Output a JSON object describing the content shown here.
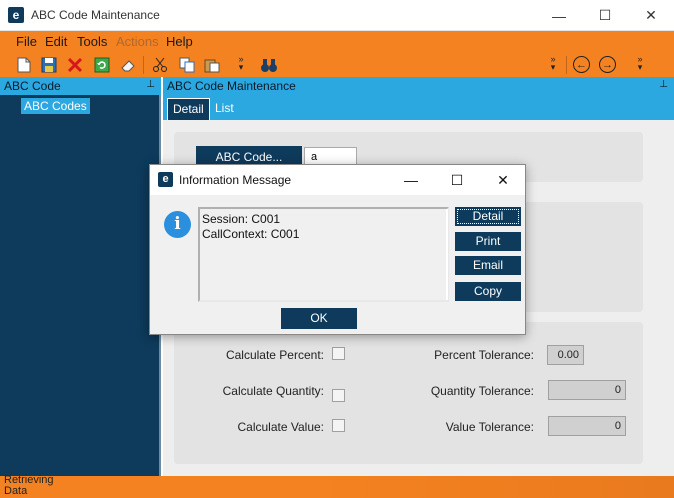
{
  "window": {
    "title": "ABC Code Maintenance",
    "minimize": "—",
    "maximize": "☐",
    "close": "✕"
  },
  "menu": {
    "items": [
      "File",
      "Edit",
      "Tools",
      "Actions",
      "Help"
    ],
    "disabled": [
      "Actions"
    ]
  },
  "toolbar": {
    "icons": [
      "new-icon",
      "save-icon",
      "delete-icon",
      "refresh-icon",
      "eraser-icon",
      "cut-icon",
      "copy-icon",
      "paste-icon",
      "binoculars-icon"
    ],
    "overflow": "»",
    "back": "←",
    "forward": "→"
  },
  "left_panel": {
    "header": "ABC Code",
    "tree_item": "ABC Codes",
    "pin": "⊥"
  },
  "main_panel": {
    "header": "ABC Code Maintenance",
    "tabs": [
      {
        "label": "Detail"
      },
      {
        "label": "List"
      }
    ],
    "key_button": "ABC Code...",
    "key_value": "a",
    "labels": {
      "calculate_percent": "Calculate Percent:",
      "calculate_quantity": "Calculate Quantity:",
      "calculate_value": "Calculate Value:",
      "percent_tolerance": "Percent Tolerance:",
      "quantity_tolerance": "Quantity Tolerance:",
      "value_tolerance": "Value Tolerance:"
    },
    "values": {
      "percent_tolerance": "0.00",
      "quantity_tolerance": "0",
      "value_tolerance": "0"
    }
  },
  "status": {
    "text": "Retrieving Data"
  },
  "dialog": {
    "title": "Information Message",
    "minimize": "—",
    "maximize": "☐",
    "close": "✕",
    "info_glyph": "i",
    "message_lines": [
      "Session: C001",
      "CallContext: C001"
    ],
    "buttons": {
      "detail": "Detail",
      "print": "Print",
      "email": "Email",
      "copy": "Copy",
      "ok": "OK"
    }
  },
  "colors": {
    "accent_orange": "#f58220",
    "navy": "#0e3a5b",
    "header_blue": "#2aa8df"
  }
}
